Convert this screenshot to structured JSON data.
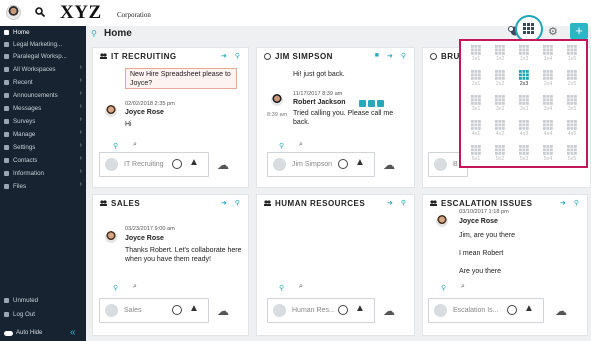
{
  "brand": {
    "name": "XYZ",
    "suffix": "Corporation"
  },
  "sidebar": {
    "items": [
      {
        "label": "Home",
        "icon": "home-icon",
        "active": true
      },
      {
        "label": "Legal Marketing...",
        "icon": "bullet-icon"
      },
      {
        "label": "Paralegal Worksp...",
        "icon": "bullet-icon"
      },
      {
        "label": "All Workspaces",
        "icon": "workspaces-icon"
      },
      {
        "label": "Recent",
        "icon": "clock-icon"
      },
      {
        "label": "Announcements",
        "icon": "megaphone-icon"
      },
      {
        "label": "Messages",
        "icon": "message-icon"
      },
      {
        "label": "Surveys",
        "icon": "survey-icon"
      },
      {
        "label": "Manage",
        "icon": "wrench-icon"
      },
      {
        "label": "Settings",
        "icon": "gear-icon"
      },
      {
        "label": "Contacts",
        "icon": "contacts-icon"
      },
      {
        "label": "Information",
        "icon": "info-icon"
      },
      {
        "label": "Files",
        "icon": "folder-icon"
      }
    ],
    "bottom": {
      "status": "Unmuted",
      "logout": "Log Out",
      "autohide": "Auto Hide"
    }
  },
  "header": {
    "title": "Home"
  },
  "cards": [
    {
      "title": "IT RECRUITING",
      "quote_text": "New Hire Spreadsheet please to Joyce?",
      "date": "02/02/2018 2:35 pm",
      "author": "Joyce Rose",
      "message": "Hi",
      "composer_placeholder": "IT Recruiting"
    },
    {
      "title": "JIM SIMPSON",
      "prev_text": "Hi! just got back.",
      "date": "11/17/2017 8:39 am",
      "author": "Robert Jackson",
      "time": "8:39 am",
      "message": "Tried calling you. Please call me back.",
      "composer_placeholder": "Jim Simpson"
    },
    {
      "title": "BRU",
      "composer_placeholder": "B"
    },
    {
      "title": "SALES",
      "date": "03/23/2017 9:00 am",
      "author": "Joyce Rose",
      "message": "Thanks Robert. Let's collaborate here when you have them ready!",
      "composer_placeholder": "Sales"
    },
    {
      "title": "HUMAN RESOURCES",
      "composer_placeholder": "Human Res..."
    },
    {
      "title": "ESCALATION ISSUES",
      "date": "03/10/2017 1:18 pm",
      "author": "Joyce Rose",
      "lines": [
        "Jim, are you there",
        "I mean Robert",
        "Are you there"
      ],
      "composer_placeholder": "Escalation Is..."
    }
  ],
  "grid_popup": {
    "rows": [
      [
        "1x1",
        "1x2",
        "1x3",
        "1x4",
        "1x5"
      ],
      [
        "2x1",
        "2x2",
        "2x3",
        "2x4",
        "2x5"
      ],
      [
        "3x1",
        "3x2",
        "3x3",
        "3x4",
        "3x5"
      ],
      [
        "4x1",
        "4x2",
        "4x3",
        "4x4",
        "4x5"
      ],
      [
        "5x1",
        "5x2",
        "5x3",
        "5x4",
        "5x5"
      ]
    ],
    "selected": "2x3"
  },
  "colors": {
    "accent": "#2bb6c6",
    "sidebar_bg": "#172331",
    "highlight": "#c2185b"
  }
}
